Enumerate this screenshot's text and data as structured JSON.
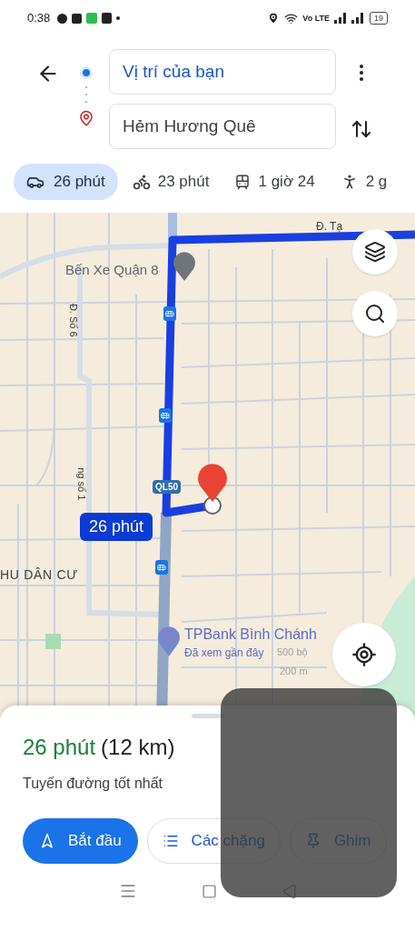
{
  "status_bar": {
    "time": "0:38",
    "network": "Vo LTE",
    "battery": "19"
  },
  "route_inputs": {
    "origin": "Vị trí của bạn",
    "destination": "Hẻm Hương Quê"
  },
  "travel_modes": [
    {
      "kind": "car",
      "label": "26 phút",
      "selected": true
    },
    {
      "kind": "motorbike",
      "label": "23 phút",
      "selected": false
    },
    {
      "kind": "transit",
      "label": "1 giờ 24",
      "selected": false
    },
    {
      "kind": "walk",
      "label": "2 g",
      "selected": false
    }
  ],
  "map": {
    "street_top": "Đ. Tạ",
    "street_left": "Đ. Số 6",
    "street_lower": "ng số 1",
    "area": "HU DÂN CƯ",
    "station": "Bến Xe Quận 8",
    "highway": "QL50",
    "route_time": "26 phút",
    "place": {
      "name": "TPBank Bình Chánh",
      "note": "Đã xem gần đây"
    },
    "scale": {
      "feet": "500 bộ",
      "meters": "200 m"
    }
  },
  "summary": {
    "duration": "26 phút",
    "distance": "(12 km)",
    "note": "Tuyến đường tốt nhất"
  },
  "actions": [
    {
      "kind": "start",
      "label": "Bắt đầu"
    },
    {
      "kind": "steps",
      "label": "Các chặng"
    },
    {
      "kind": "pin",
      "label": "Ghim"
    }
  ]
}
